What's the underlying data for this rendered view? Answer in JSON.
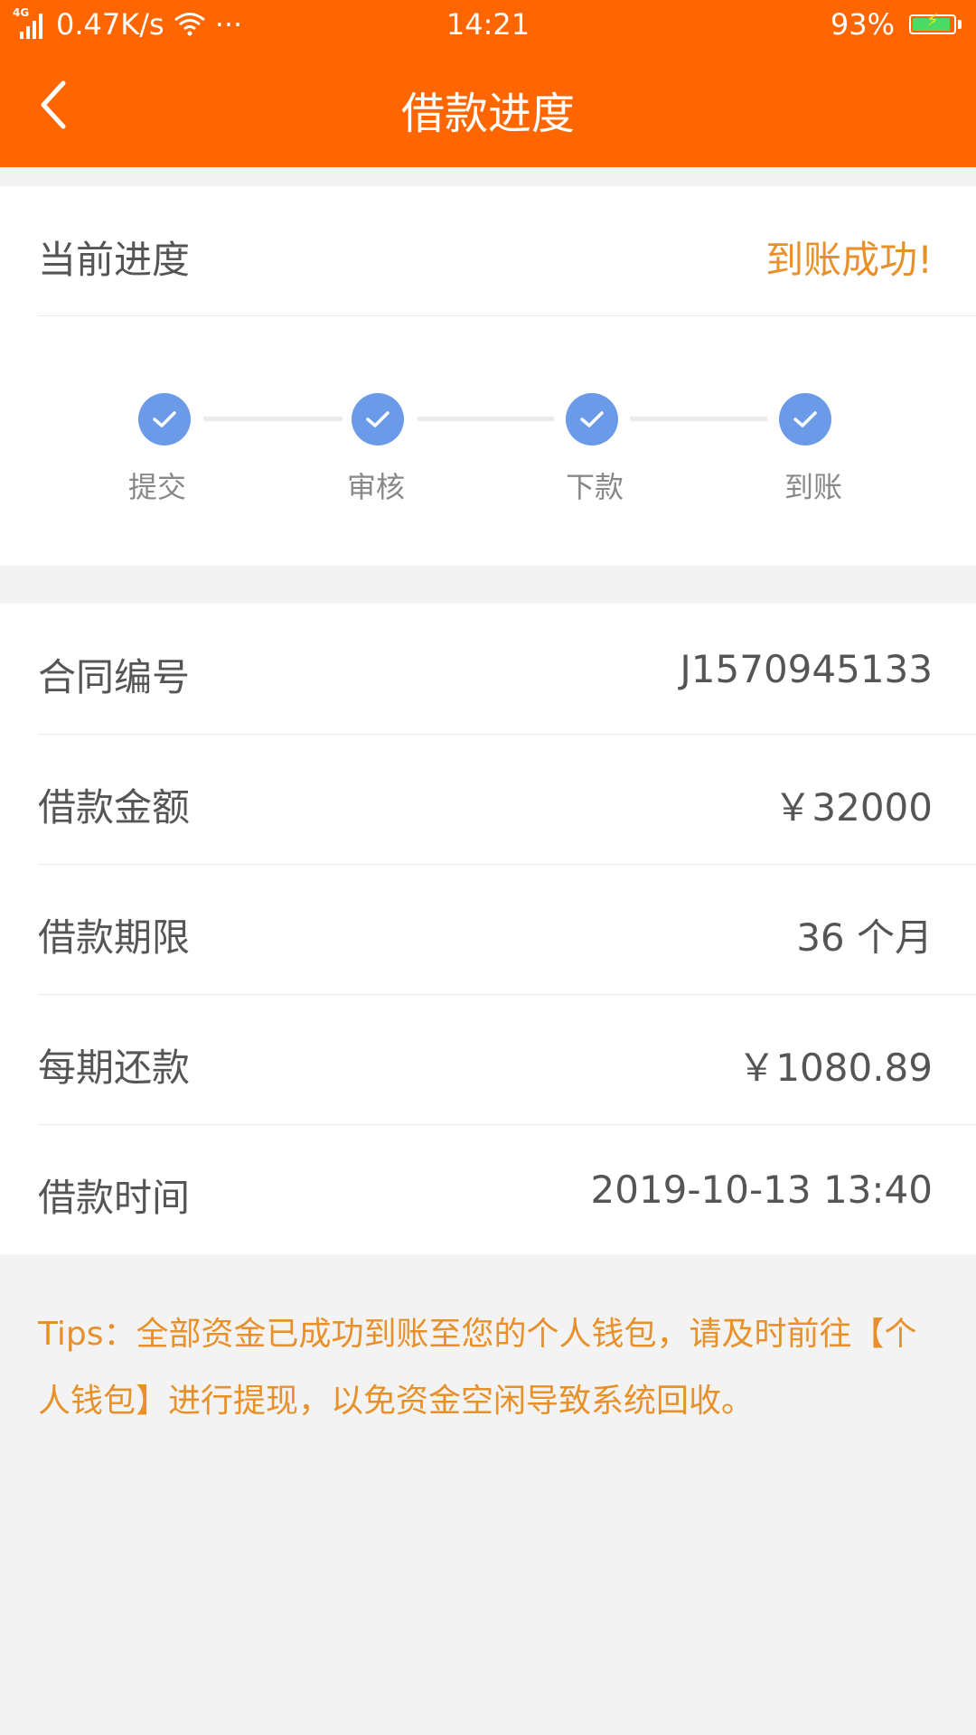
{
  "status_bar": {
    "network": "4G",
    "speed": "0.47K/s",
    "more": "···",
    "time": "14:21",
    "battery_percent": "93%",
    "battery_level": 0.93
  },
  "header": {
    "title": "借款进度"
  },
  "progress": {
    "label": "当前进度",
    "status": "到账成功!",
    "steps": [
      {
        "label": "提交",
        "done": true
      },
      {
        "label": "审核",
        "done": true
      },
      {
        "label": "下款",
        "done": true
      },
      {
        "label": "到账",
        "done": true
      }
    ]
  },
  "info": {
    "rows": [
      {
        "label": "合同编号",
        "value": "J1570945133"
      },
      {
        "label": "借款金额",
        "value": "￥32000"
      },
      {
        "label": "借款期限",
        "value": "36 个月"
      },
      {
        "label": "每期还款",
        "value": "￥1080.89"
      },
      {
        "label": "借款时间",
        "value": "2019-10-13 13:40"
      }
    ]
  },
  "tips": {
    "text": "Tips：全部资金已成功到账至您的个人钱包，请及时前往【个人钱包】进行提现，以免资金空闲导致系统回收。"
  },
  "colors": {
    "brand": "#ff6600",
    "accent": "#e8902a",
    "step_done": "#6b9be8"
  }
}
